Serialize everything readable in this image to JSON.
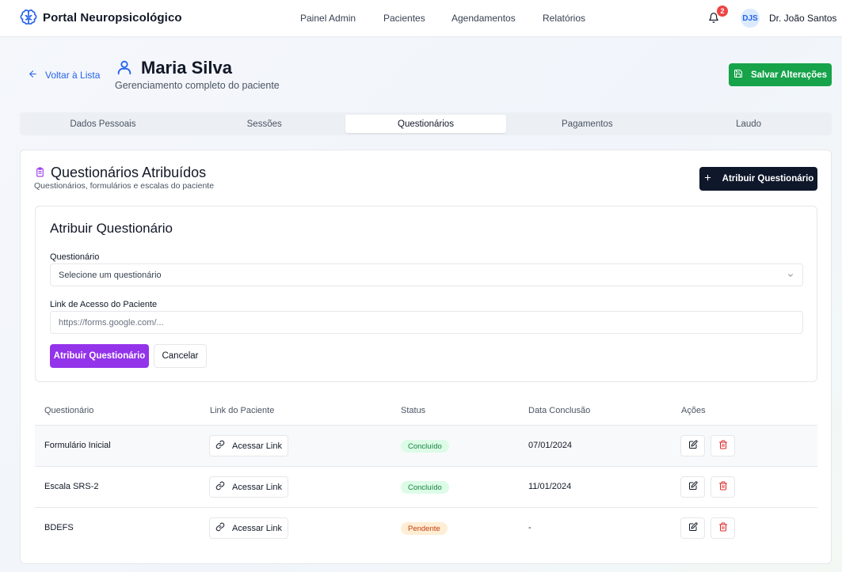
{
  "app": {
    "title": "Portal Neuropsicológico",
    "nav": [
      "Painel Admin",
      "Pacientes",
      "Agendamentos",
      "Relatórios"
    ],
    "notifications": "2",
    "user_initials": "DJS",
    "user_name": "Dr. João Santos"
  },
  "header": {
    "back_label": "Voltar à Lista",
    "patient_name": "Maria Silva",
    "subtitle": "Gerenciamento completo do paciente",
    "save_label": "Salvar Alterações"
  },
  "tabs": [
    {
      "label": "Dados Pessoais",
      "active": false
    },
    {
      "label": "Sessões",
      "active": false
    },
    {
      "label": "Questionários",
      "active": true
    },
    {
      "label": "Pagamentos",
      "active": false
    },
    {
      "label": "Laudo",
      "active": false
    }
  ],
  "section": {
    "title": "Questionários Atribuídos",
    "subtitle": "Questionários, formulários e escalas do paciente",
    "assign_button": "Atribuir Questionário"
  },
  "form": {
    "title": "Atribuir Questionário",
    "questionnaire_label": "Questionário",
    "questionnaire_value": "Selecione um questionário",
    "link_label": "Link de Acesso do Paciente",
    "link_placeholder": "https://forms.google.com/...",
    "submit_label": "Atribuir Questionário",
    "cancel_label": "Cancelar"
  },
  "table": {
    "headers": [
      "Questionário",
      "Link do Paciente",
      "Status",
      "Data Conclusão",
      "Ações"
    ],
    "link_label": "Acessar Link",
    "rows": [
      {
        "name": "Formulário Inicial",
        "status": "Concluído",
        "status_type": "done",
        "date": "07/01/2024"
      },
      {
        "name": "Escala SRS-2",
        "status": "Concluído",
        "status_type": "done",
        "date": "11/01/2024"
      },
      {
        "name": "BDEFS",
        "status": "Pendente",
        "status_type": "pending",
        "date": "-"
      }
    ]
  },
  "colors": {
    "primary_blue": "#2563eb",
    "success_green": "#16a34a",
    "accent_purple": "#9333ea",
    "dark_button": "#0f172a",
    "danger_red": "#dc2626"
  },
  "icons": [
    "brain-icon",
    "bell-icon",
    "arrow-left-icon",
    "user-icon",
    "save-icon",
    "clipboard-icon",
    "plus-icon",
    "chevron-down-icon",
    "link-icon",
    "edit-icon",
    "trash-icon"
  ]
}
